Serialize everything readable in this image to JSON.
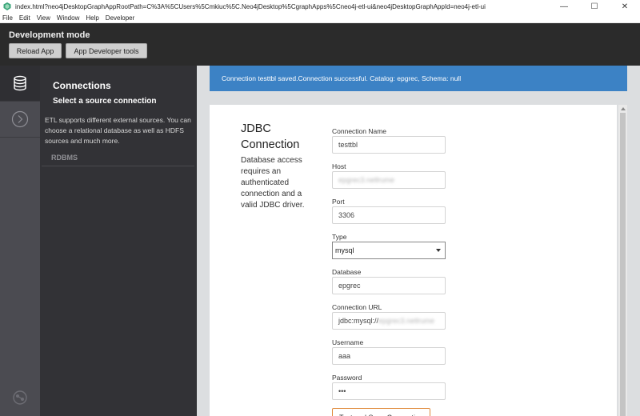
{
  "window": {
    "title": "index.html?neo4jDesktopGraphAppRootPath=C%3A%5CUsers%5Cmkiuc%5C.Neo4jDesktop%5CgraphApps%5Cneo4j-etl-ui&neo4jDesktopGraphAppId=neo4j-etl-ui",
    "minimize": "—",
    "maximize": "☐",
    "close": "✕"
  },
  "menu": [
    "File",
    "Edit",
    "View",
    "Window",
    "Help",
    "Developer"
  ],
  "devbar": {
    "title": "Development mode",
    "reload_label": "Reload App",
    "devtools_label": "App Developer tools"
  },
  "rail": {
    "icons": [
      "database-icon",
      "arrow-circle-icon",
      "neo4j-logo-icon"
    ]
  },
  "panel": {
    "title": "Connections",
    "subtitle": "Select a source connection",
    "description": "ETL supports different external sources. You can choose a relational database as well as HDFS sources and much more.",
    "section": "RDBMS"
  },
  "alert": {
    "message": "Connection testtbl saved.Connection successful. Catalog: epgrec, Schema: null"
  },
  "form": {
    "title_line1": "JDBC",
    "title_line2": "Connection",
    "description": "Database access requires an authenticated connection and a valid JDBC driver.",
    "connection_name_label": "Connection Name",
    "connection_name_value": "testtbl",
    "host_label": "Host",
    "host_value": "epgrec3.netlrume",
    "port_label": "Port",
    "port_value": "3306",
    "type_label": "Type",
    "type_value": "mysql",
    "database_label": "Database",
    "database_value": "epgrec",
    "url_label": "Connection URL",
    "url_prefix": "jdbc:mysql://",
    "url_blurred": "epgrec3.netlrume",
    "username_label": "Username",
    "username_value": "aaa",
    "password_label": "Password",
    "password_value": "•••",
    "test_button_label": "Test and Save Connection"
  }
}
